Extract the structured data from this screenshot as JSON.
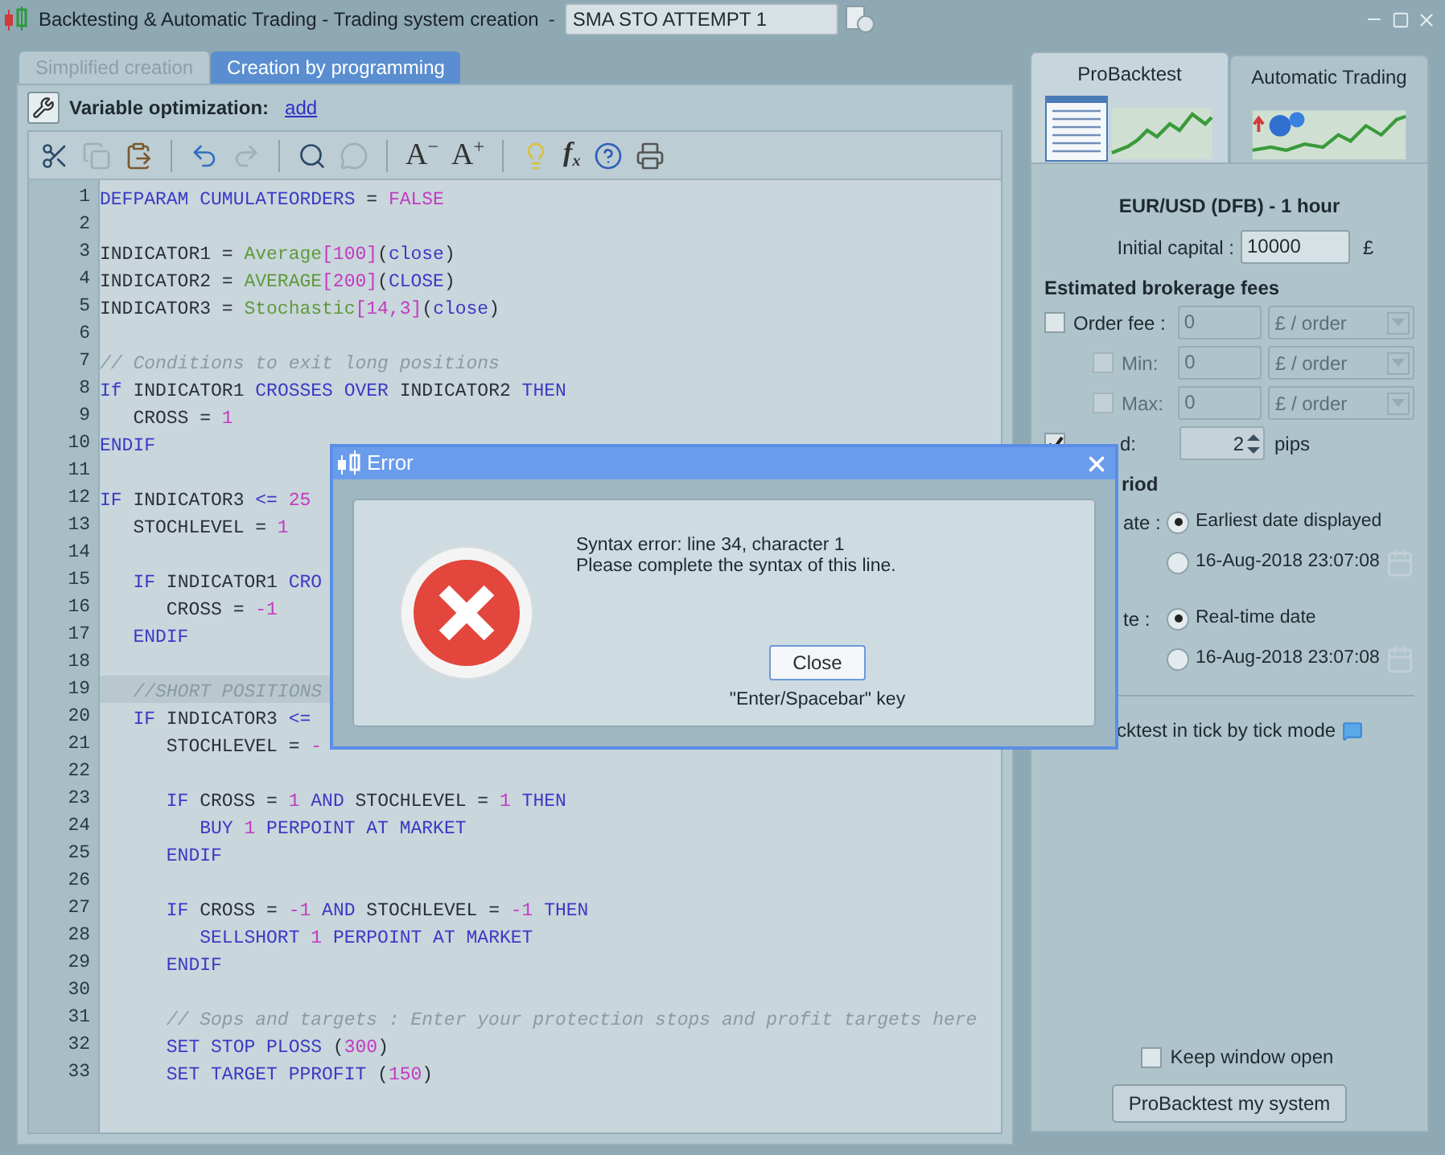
{
  "window": {
    "title": "Backtesting & Automatic Trading - Trading system creation",
    "separator": "-",
    "system_name": "SMA STO ATTEMPT 1"
  },
  "tabs": [
    {
      "label": "Simplified creation",
      "selected": false
    },
    {
      "label": "Creation by programming",
      "selected": true
    }
  ],
  "variable_optimization": {
    "label": "Variable optimization:",
    "link": "add"
  },
  "toolbar": [
    {
      "kind": "cut",
      "disabled": false
    },
    {
      "kind": "copy",
      "disabled": true
    },
    {
      "kind": "paste",
      "disabled": false
    },
    {
      "kind": "separator"
    },
    {
      "kind": "undo",
      "disabled": false
    },
    {
      "kind": "redo",
      "disabled": true
    },
    {
      "kind": "separator"
    },
    {
      "kind": "search",
      "disabled": false
    },
    {
      "kind": "comment",
      "disabled": true
    },
    {
      "kind": "separator"
    },
    {
      "kind": "font_smaller",
      "glyph": "A",
      "badge": "−",
      "disabled": false
    },
    {
      "kind": "font_bigger",
      "glyph": "A",
      "badge": "+",
      "disabled": false
    },
    {
      "kind": "separator"
    },
    {
      "kind": "tip",
      "disabled": false
    },
    {
      "kind": "function",
      "glyph": "f",
      "sub": "x",
      "disabled": false
    },
    {
      "kind": "help",
      "disabled": false
    },
    {
      "kind": "print",
      "disabled": false
    }
  ],
  "code_lines": [
    {
      "number": "1",
      "highlighted": false,
      "tokens": [
        {
          "kind": "kw",
          "text": "DEFPARAM CUMULATEORDERS"
        },
        {
          "kind": "plain",
          "text": " = "
        },
        {
          "kind": "num",
          "text": "FALSE"
        }
      ]
    },
    {
      "number": "2",
      "highlighted": false
    },
    {
      "number": "3",
      "highlighted": false,
      "tokens": [
        {
          "kind": "plain",
          "text": "INDICATOR1 = "
        },
        {
          "kind": "fn",
          "text": "Average"
        },
        {
          "kind": "num",
          "text": "[100]"
        },
        {
          "kind": "plain",
          "text": "("
        },
        {
          "kind": "kw",
          "text": "close"
        },
        {
          "kind": "plain",
          "text": ")"
        }
      ]
    },
    {
      "number": "4",
      "highlighted": false,
      "tokens": [
        {
          "kind": "plain",
          "text": "INDICATOR2 = "
        },
        {
          "kind": "fn",
          "text": "AVERAGE"
        },
        {
          "kind": "num",
          "text": "[200]"
        },
        {
          "kind": "plain",
          "text": "("
        },
        {
          "kind": "kw",
          "text": "CLOSE"
        },
        {
          "kind": "plain",
          "text": ")"
        }
      ]
    },
    {
      "number": "5",
      "highlighted": false,
      "tokens": [
        {
          "kind": "plain",
          "text": "INDICATOR3 = "
        },
        {
          "kind": "fn",
          "text": "Stochastic"
        },
        {
          "kind": "num",
          "text": "[14,3]"
        },
        {
          "kind": "plain",
          "text": "("
        },
        {
          "kind": "kw",
          "text": "close"
        },
        {
          "kind": "plain",
          "text": ")"
        }
      ]
    },
    {
      "number": "6",
      "highlighted": false
    },
    {
      "number": "7",
      "highlighted": false,
      "tokens": [
        {
          "kind": "comment",
          "text": "// Conditions to exit long positions"
        }
      ]
    },
    {
      "number": "8",
      "highlighted": false,
      "tokens": [
        {
          "kind": "kw",
          "text": "If"
        },
        {
          "kind": "plain",
          "text": " INDICATOR1 "
        },
        {
          "kind": "kw",
          "text": "CROSSES OVER"
        },
        {
          "kind": "plain",
          "text": " INDICATOR2 "
        },
        {
          "kind": "kw",
          "text": "THEN"
        }
      ]
    },
    {
      "number": "9",
      "highlighted": false,
      "tokens": [
        {
          "kind": "plain",
          "text": "   CROSS = "
        },
        {
          "kind": "num",
          "text": "1"
        }
      ]
    },
    {
      "number": "10",
      "highlighted": false,
      "tokens": [
        {
          "kind": "kw",
          "text": "ENDIF"
        }
      ]
    },
    {
      "number": "11",
      "highlighted": false
    },
    {
      "number": "12",
      "highlighted": false,
      "tokens": [
        {
          "kind": "kw",
          "text": "IF"
        },
        {
          "kind": "plain",
          "text": " INDICATOR3 "
        },
        {
          "kind": "kw",
          "text": "<="
        },
        {
          "kind": "num",
          "text": " 25"
        }
      ]
    },
    {
      "number": "13",
      "highlighted": false,
      "tokens": [
        {
          "kind": "plain",
          "text": "   STOCHLEVEL = "
        },
        {
          "kind": "num",
          "text": "1"
        }
      ]
    },
    {
      "number": "14",
      "highlighted": false
    },
    {
      "number": "15",
      "highlighted": false,
      "tokens": [
        {
          "kind": "kw",
          "text": "   IF"
        },
        {
          "kind": "plain",
          "text": " INDICATOR1 "
        },
        {
          "kind": "kw",
          "text": "CRO"
        }
      ]
    },
    {
      "number": "16",
      "highlighted": false,
      "tokens": [
        {
          "kind": "plain",
          "text": "      CROSS = "
        },
        {
          "kind": "num",
          "text": "-1"
        }
      ]
    },
    {
      "number": "17",
      "highlighted": false,
      "tokens": [
        {
          "kind": "kw",
          "text": "   ENDIF"
        }
      ]
    },
    {
      "number": "18",
      "highlighted": false
    },
    {
      "number": "19",
      "highlighted": true,
      "tokens": [
        {
          "kind": "comment",
          "text": "   //SHORT POSITIONS"
        }
      ]
    },
    {
      "number": "20",
      "highlighted": false,
      "tokens": [
        {
          "kind": "kw",
          "text": "   IF"
        },
        {
          "kind": "plain",
          "text": " INDICATOR3 "
        },
        {
          "kind": "kw",
          "text": "<="
        }
      ]
    },
    {
      "number": "21",
      "highlighted": false,
      "tokens": [
        {
          "kind": "plain",
          "text": "      STOCHLEVEL = "
        },
        {
          "kind": "num",
          "text": "-"
        }
      ]
    },
    {
      "number": "22",
      "highlighted": false
    },
    {
      "number": "23",
      "highlighted": false,
      "tokens": [
        {
          "kind": "kw",
          "text": "      IF"
        },
        {
          "kind": "plain",
          "text": " CROSS = "
        },
        {
          "kind": "num",
          "text": "1"
        },
        {
          "kind": "kw",
          "text": " AND"
        },
        {
          "kind": "plain",
          "text": " STOCHLEVEL = "
        },
        {
          "kind": "num",
          "text": "1"
        },
        {
          "kind": "kw",
          "text": " THEN"
        }
      ]
    },
    {
      "number": "24",
      "highlighted": false,
      "tokens": [
        {
          "kind": "kw",
          "text": "         BUY"
        },
        {
          "kind": "num",
          "text": " 1"
        },
        {
          "kind": "kw",
          "text": " PERPOINT AT MARKET"
        }
      ]
    },
    {
      "number": "25",
      "highlighted": false,
      "tokens": [
        {
          "kind": "kw",
          "text": "      ENDIF"
        }
      ]
    },
    {
      "number": "26",
      "highlighted": false
    },
    {
      "number": "27",
      "highlighted": false,
      "tokens": [
        {
          "kind": "kw",
          "text": "      IF"
        },
        {
          "kind": "plain",
          "text": " CROSS = "
        },
        {
          "kind": "num",
          "text": "-1"
        },
        {
          "kind": "kw",
          "text": " AND"
        },
        {
          "kind": "plain",
          "text": " STOCHLEVEL = "
        },
        {
          "kind": "num",
          "text": "-1"
        },
        {
          "kind": "kw",
          "text": " THEN"
        }
      ]
    },
    {
      "number": "28",
      "highlighted": false,
      "tokens": [
        {
          "kind": "kw",
          "text": "         SELLSHORT"
        },
        {
          "kind": "num",
          "text": " 1"
        },
        {
          "kind": "kw",
          "text": " PERPOINT AT MARKET"
        }
      ]
    },
    {
      "number": "29",
      "highlighted": false,
      "tokens": [
        {
          "kind": "kw",
          "text": "      ENDIF"
        }
      ]
    },
    {
      "number": "30",
      "highlighted": false
    },
    {
      "number": "31",
      "highlighted": false,
      "tokens": [
        {
          "kind": "comment",
          "text": "      // Sops and targets : Enter your protection stops and profit targets here"
        }
      ]
    },
    {
      "number": "32",
      "highlighted": false,
      "tokens": [
        {
          "kind": "kw",
          "text": "      SET STOP PLOSS"
        },
        {
          "kind": "plain",
          "text": " ("
        },
        {
          "kind": "num",
          "text": "300"
        },
        {
          "kind": "plain",
          "text": ")"
        }
      ]
    },
    {
      "number": "33",
      "highlighted": false,
      "tokens": [
        {
          "kind": "kw",
          "text": "      SET TARGET PPROFIT"
        },
        {
          "kind": "plain",
          "text": " ("
        },
        {
          "kind": "num",
          "text": "150"
        },
        {
          "kind": "plain",
          "text": ")"
        }
      ]
    }
  ],
  "side_tabs": [
    {
      "label": "ProBacktest",
      "kind": "backtest",
      "selected": true
    },
    {
      "label": "Automatic Trading",
      "kind": "trading",
      "selected": false
    }
  ],
  "backtest": {
    "instrument": "EUR/USD (DFB) - 1 hour",
    "capital_label": "Initial capital :",
    "capital_value": "10000",
    "currency": "£",
    "fees_heading": "Estimated brokerage fees",
    "fees": [
      {
        "label": "Order fee :",
        "checked": false,
        "disabled": false,
        "value": "0",
        "unit": "£ / order"
      },
      {
        "label": "Min:",
        "checked": false,
        "disabled": true,
        "value": "0",
        "unit": "£ / order"
      },
      {
        "label": "Max:",
        "checked": false,
        "disabled": true,
        "value": "0",
        "unit": "£ / order"
      }
    ],
    "spread": {
      "label": "d:",
      "checked": true,
      "value": "2",
      "unit": "pips"
    },
    "period_heading": "riod",
    "start": {
      "label": "ate :",
      "options": [
        {
          "label": "Earliest date displayed",
          "selected": true
        },
        {
          "label": "16-Aug-2018 23:07:08",
          "selected": false
        }
      ]
    },
    "end": {
      "label": "te :",
      "options": [
        {
          "label": "Real-time date",
          "selected": true
        },
        {
          "label": "16-Aug-2018 23:07:08",
          "selected": false
        }
      ]
    },
    "tick_mode": "cktest in tick by tick mode",
    "keep_open": {
      "label": "Keep window open",
      "checked": false
    },
    "run_button": "ProBacktest my system"
  },
  "dialog": {
    "title": "Error",
    "message": [
      "Syntax error: line 34, character 1",
      "Please complete the syntax of this line."
    ],
    "button": "Close",
    "hint": "\"Enter/Spacebar\" key"
  }
}
